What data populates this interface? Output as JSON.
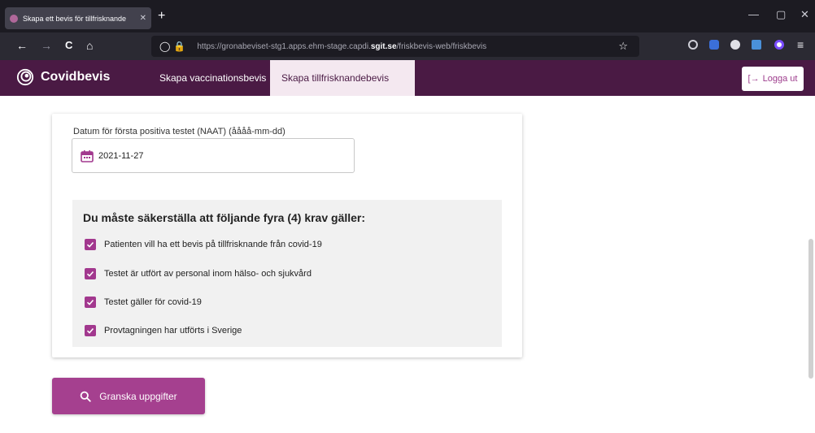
{
  "browser": {
    "tab_title": "Skapa ett bevis för tillfrisknande",
    "new_tab": "+",
    "window_minimize": "—",
    "window_maximize": "▢",
    "window_close": "✕",
    "nav_back": "←",
    "nav_forward": "→",
    "nav_reload": "C",
    "nav_home": "⌂",
    "url_prefix": "https://gronabeviset-stg1.apps.ehm-stage.capdi.",
    "url_domain": "sgit.se",
    "url_suffix": "/friskbevis-web/friskbevis"
  },
  "header": {
    "logo_text": "Covidbevis",
    "nav": [
      {
        "label": "Skapa vaccinationsbevis"
      },
      {
        "label": "Skapa tillfrisknandebevis"
      }
    ],
    "logout_label": "Logga ut"
  },
  "form": {
    "date_label": "Datum för första positiva testet (NAAT) (åååå-mm-dd)",
    "date_value": "2021-11-27",
    "requirements_title": "Du måste säkerställa att följande fyra (4) krav gäller:",
    "requirements": [
      {
        "label": "Patienten vill ha ett bevis på tillfrisknande från covid-19"
      },
      {
        "label": "Testet är utfört av personal inom hälso- och sjukvård"
      },
      {
        "label": "Testet gäller för covid-19"
      },
      {
        "label": "Provtagningen har utförts i Sverige"
      }
    ],
    "review_button": "Granska uppgifter"
  },
  "colors": {
    "header_bg": "#4a1a44",
    "accent": "#a5408f",
    "checkbox": "#a2388e"
  }
}
